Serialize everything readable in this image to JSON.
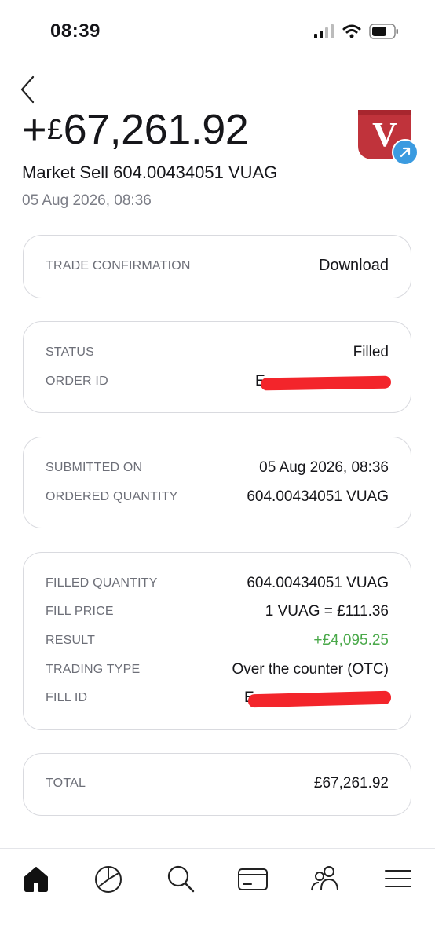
{
  "status_bar": {
    "time": "08:39"
  },
  "header": {
    "amount_sign": "+",
    "amount_currency": "£",
    "amount_value": "67,261.92",
    "subtitle": "Market Sell 604.00434051 VUAG",
    "datetime": "05 Aug 2026, 08:36",
    "logo_letter": "V"
  },
  "trade_confirmation": {
    "label": "TRADE CONFIRMATION",
    "action": "Download"
  },
  "order_card": {
    "status_label": "STATUS",
    "status_value": "Filled",
    "order_id_label": "ORDER ID",
    "order_id_visible": "E"
  },
  "submission_card": {
    "submitted_label": "SUBMITTED ON",
    "submitted_value": "05 Aug 2026, 08:36",
    "ordered_qty_label": "ORDERED QUANTITY",
    "ordered_qty_value": "604.00434051 VUAG"
  },
  "fill_card": {
    "filled_qty_label": "FILLED QUANTITY",
    "filled_qty_value": "604.00434051 VUAG",
    "fill_price_label": "FILL PRICE",
    "fill_price_value": "1 VUAG = £111.36",
    "result_label": "RESULT",
    "result_value": "+£4,095.25",
    "trading_type_label": "TRADING TYPE",
    "trading_type_value": "Over the counter (OTC)",
    "fill_id_label": "FILL ID",
    "fill_id_visible": "E"
  },
  "total_card": {
    "label": "TOTAL",
    "value": "£67,261.92"
  },
  "bottom_nav": {
    "items": [
      "home-icon",
      "portfolio-pie-icon",
      "search-icon",
      "card-icon",
      "community-icon",
      "menu-icon"
    ],
    "active": "home-icon"
  },
  "colors": {
    "positive": "#4aa94a",
    "logo_red": "#c0333b",
    "badge_blue": "#3b9be0",
    "redaction": "#f3252b"
  }
}
